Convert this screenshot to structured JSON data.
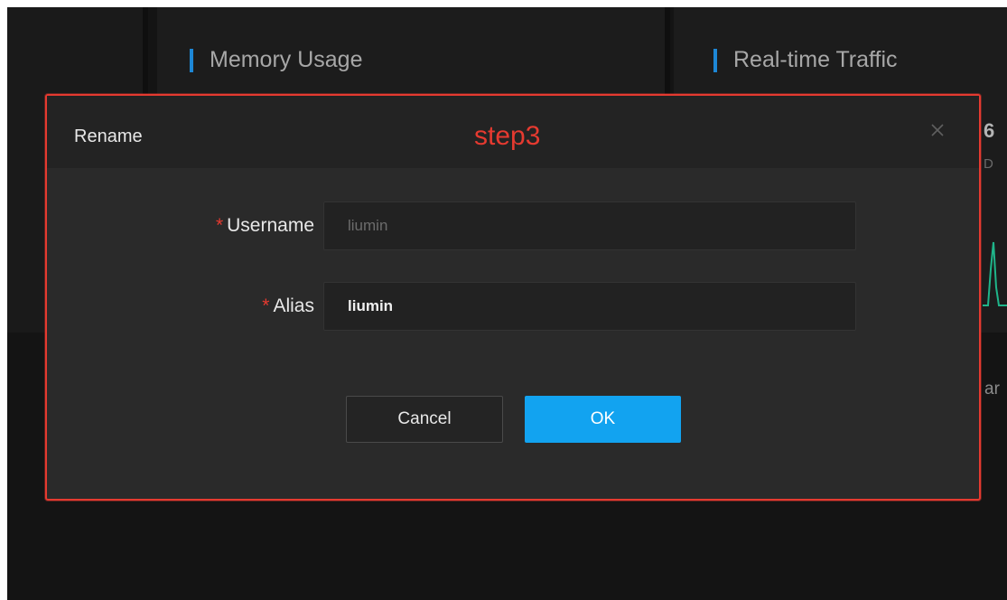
{
  "dashboard": {
    "memory_panel_title": "Memory Usage",
    "traffic_panel_title": "Real-time Traffic",
    "edge_value": "6",
    "edge_sub": "D",
    "edge_text": "ar",
    "accent_color": "#1d87d6"
  },
  "dialog": {
    "title": "Rename",
    "annotation": "step3",
    "close_icon": "close-icon",
    "fields": {
      "username": {
        "required_mark": "*",
        "label": "Username",
        "value": "liumin",
        "disabled": true
      },
      "alias": {
        "required_mark": "*",
        "label": "Alias",
        "value": "liumin"
      }
    },
    "cancel_label": "Cancel",
    "ok_label": "OK",
    "highlight_color": "#e53a30",
    "primary_color": "#12a3f0"
  }
}
